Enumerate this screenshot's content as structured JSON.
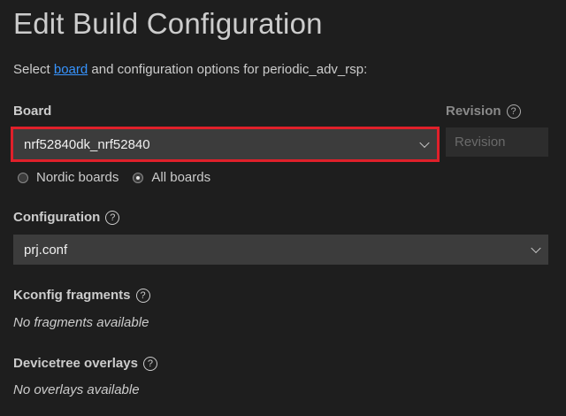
{
  "page": {
    "title": "Edit Build Configuration",
    "subtitle_prefix": "Select ",
    "subtitle_link": "board",
    "subtitle_suffix": " and configuration options for periodic_adv_rsp:"
  },
  "board": {
    "label": "Board",
    "selected": "nrf52840dk_nrf52840",
    "radio_options": [
      {
        "label": "Nordic boards",
        "checked": false
      },
      {
        "label": "All boards",
        "checked": true
      }
    ]
  },
  "revision": {
    "label": "Revision",
    "help": "?",
    "placeholder": "Revision"
  },
  "configuration": {
    "label": "Configuration",
    "help": "?",
    "selected": "prj.conf"
  },
  "kconfig": {
    "label": "Kconfig fragments",
    "help": "?",
    "empty_text": "No fragments available"
  },
  "devicetree": {
    "label": "Devicetree overlays",
    "help": "?",
    "empty_text": "No overlays available"
  },
  "colors": {
    "background": "#1e1e1e",
    "link": "#3794ff",
    "highlight": "#e0202a",
    "input_bg": "#3c3c3c"
  }
}
